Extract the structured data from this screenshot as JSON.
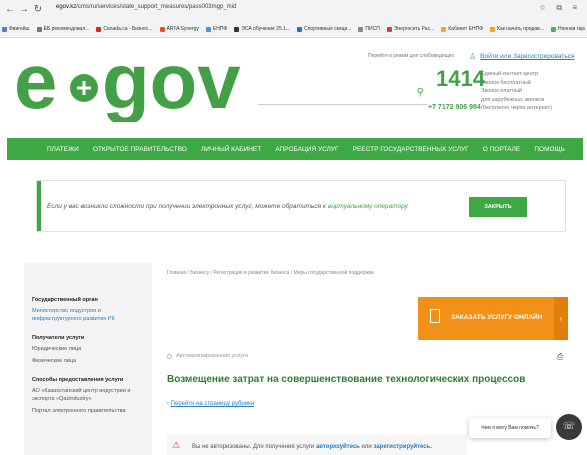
{
  "browser": {
    "url_host": "egov.kz",
    "url_path": "/cms/ru/services/state_support_measures/pass003mgp_mid",
    "bookmarks": [
      {
        "label": "Фвигейш",
        "color": "#5b7cc9"
      },
      {
        "label": "ЕБ рекомендовал...",
        "color": "#777777"
      },
      {
        "label": "Canada.ca - Бизнес...",
        "color": "#d52b1e"
      },
      {
        "label": "ARTA Synergy",
        "color": "#e94e1b"
      },
      {
        "label": "ЕНПФ",
        "color": "#4a90d9"
      },
      {
        "label": "ЭСА обучение 25.1...",
        "color": "#333333"
      },
      {
        "label": "Спортивные секци...",
        "color": "#1976d2"
      },
      {
        "label": "ПИСП",
        "color": "#888888"
      },
      {
        "label": "Энергосеть Рас...",
        "color": "#e53935"
      },
      {
        "label": "Кабинет ЕНПФ",
        "color": "#f5a623"
      },
      {
        "label": "Как начать продав...",
        "color": "#f5a623"
      },
      {
        "label": "Нонная гаража",
        "color": "#4caf50"
      }
    ]
  },
  "header": {
    "logo_text": "egov",
    "visually_impaired": "Перейти в режим для слабовидящих",
    "login": "Войти или Зарегистрироваться",
    "phone_big": "1414",
    "phone_small": "+7 7172 906 984",
    "contact": {
      "line1": "Единый контакт-центр",
      "line2": "Звонок бесплатный",
      "line3": "Звонок платный",
      "line4": "для зарубежных звонков",
      "line5": "(бесплатно через интернет)"
    }
  },
  "nav": {
    "items": [
      "ПЛАТЕЖИ",
      "ОТКРЫТОЕ ПРАВИТЕЛЬСТВО",
      "ЛИЧНЫЙ КАБИНЕТ",
      "АПРОБАЦИЯ УСЛУГ",
      "РЕЕСТР ГОСУДАРСТВЕННЫХ УСЛУГ",
      "О ПОРТАЛЕ",
      "ПОМОЩЬ"
    ]
  },
  "notice": {
    "text": "Если у вас возникли сложности при получении электронных услуг, можете обратиться к",
    "link": "виртуальному оператору",
    "button": "ЗАКРЫТЬ"
  },
  "sidebar": {
    "gov_body_h": "Государственный орган",
    "gov_body": "Министерство индустрии и инфраструктурного развития РК",
    "recipients_h": "Получатели услуги",
    "recipient_1": "Юридические лица",
    "recipient_2": "Физические лица",
    "methods_h": "Способы предоставления услуги",
    "method_1": "АО «Казахстанский центр индустрии и экспорта «Qazindustry»",
    "method_2": "Портал электронного правительства"
  },
  "main": {
    "breadcrumbs": "Главная / Бизнесу / Регистрация и развитие бизнеса / Меры государственной поддержки",
    "order_button": "ЗАКАЗАТЬ УСЛУГУ ОНЛАЙН",
    "automated": "Автоматизированная услуга",
    "title": "Возмещение затрат на совершенствование технологических процессов",
    "back_link": "Перейти на страницу рубрики",
    "alert_text": "Вы не авторизованы. Для получения услуги",
    "alert_link1": "авторизуйтесь",
    "alert_or": "или",
    "alert_link2": "зарегистрируйтесь."
  },
  "help": {
    "prompt": "Чем я могу Вам помочь?"
  },
  "colors": {
    "brand_green": "#3ea944",
    "orange": "#f29117",
    "link_blue": "#2a7fbf"
  }
}
